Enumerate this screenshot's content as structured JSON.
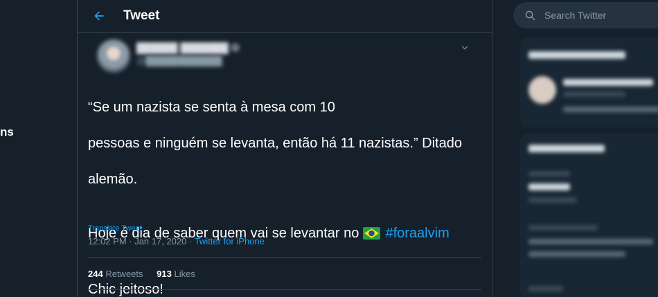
{
  "leftnav": {
    "fragment": "ns"
  },
  "header": {
    "title": "Tweet"
  },
  "tweet": {
    "text_line1": "“Se um nazista se senta à mesa com 10",
    "text_line2": "pessoas e ninguém se levanta, então há 11 nazistas.” Ditado",
    "text_line3": "alemão.",
    "text_line4_before": "Hoje é dia de saber quem vai se levantar no ",
    "hashtag": "#foraalvim",
    "text_line5": "Chic jeitoso!",
    "translate_label": "Translate Tweet",
    "timestamp": "12:02 PM · Jan 17, 2020 · ",
    "source": "Twitter for iPhone",
    "retweets_count": "244",
    "retweets_label": "Retweets",
    "likes_count": "913",
    "likes_label": "Likes"
  },
  "search": {
    "placeholder": "Search Twitter"
  },
  "colors": {
    "accent": "#1da1f2",
    "background": "#15202b",
    "border": "#38444d",
    "muted": "#8899a6"
  }
}
